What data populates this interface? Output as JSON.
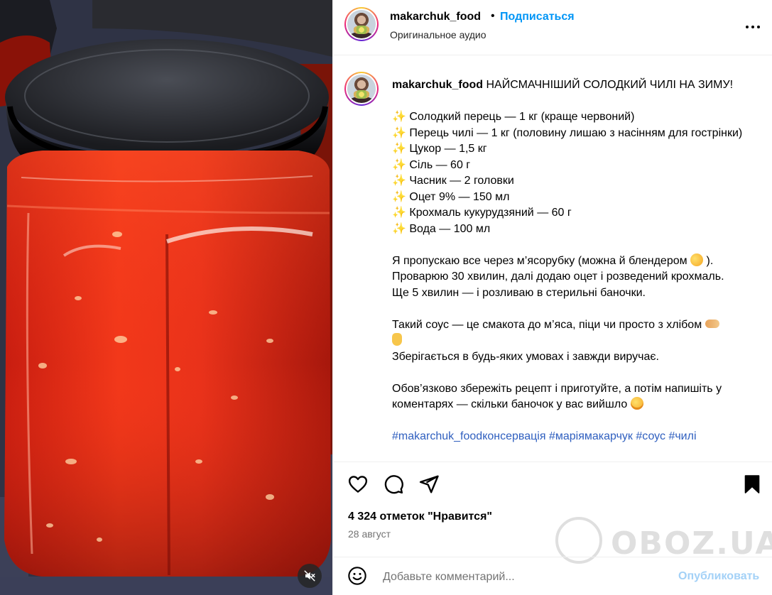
{
  "header": {
    "username": "makarchuk_food",
    "separator": "•",
    "follow_label": "Подписаться",
    "audio_label": "Оригинальное аудио"
  },
  "caption": {
    "username": "makarchuk_food",
    "title": "НАЙСМАЧНІШИЙ СОЛОДКИЙ ЧИЛІ НА ЗИМУ!",
    "sparkle": "✨",
    "ingredients": [
      "Солодкий перець — 1 кг (краще червоний)",
      "Перець чилі — 1 кг (половину лишаю з насінням для гострінки)",
      "Цукор — 1,5 кг",
      "Сіль — 60 г",
      "Часник — 2 головки",
      "Оцет 9% — 150 мл",
      "Крохмаль кукурудзяний — 60 г",
      "Вода — 100 мл"
    ],
    "para1_line1": "Я пропускаю все через м’ясорубку (можна й блендером",
    "para1_line1_end": ").",
    "para1_line2": "Проварюю 30 хвилин, далі додаю оцет і розведений крохмаль.",
    "para1_line3": "Ще 5 хвилин — і розливаю в стерильні баночки.",
    "para2_line1": "Такий соус — це смакота до м’яса, піци чи просто з хлібом",
    "para2_line2": "Зберігається в будь-яких умовах і завжди виручає.",
    "para3": "Обов’язково збережіть рецепт і приготуйте, а потім напишіть у коментарях — скільки баночок у вас вийшло",
    "hashtags": [
      "#makarchuk_foodконсервація",
      "#маріямакарчук",
      "#соус",
      "#чилі"
    ]
  },
  "stats": {
    "likes": "4 324 отметок \"Нравится\"",
    "date": "28 август"
  },
  "comment": {
    "placeholder": "Добавьте комментарий...",
    "post_label": "Опубликовать"
  },
  "icons": {
    "like": "heart-icon",
    "comment": "comment-icon",
    "share": "share-icon",
    "save": "bookmark-icon",
    "more": "more-icon",
    "emoji": "emoji-icon",
    "mute": "muted-speaker-icon"
  },
  "colors": {
    "accent": "#0095f6",
    "hashtag": "#00376b",
    "muted_text": "#737373",
    "post_disabled": "#a3d1f7"
  },
  "watermark": {
    "text": "OBOZ.UA"
  }
}
